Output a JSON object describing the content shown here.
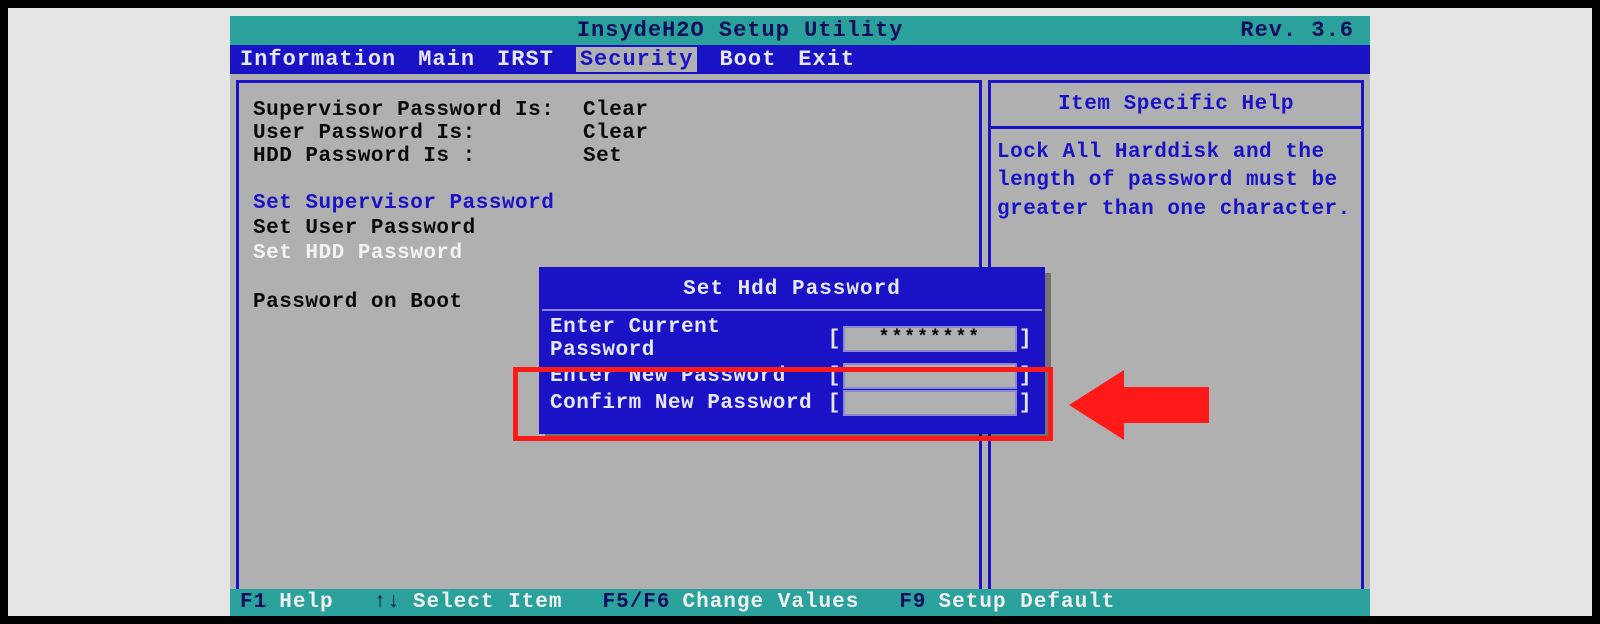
{
  "titlebar": {
    "title": "InsydeH2O Setup Utility",
    "rev": "Rev. 3.6"
  },
  "menubar": {
    "tabs": [
      "Information",
      "Main",
      "IRST",
      "Security",
      "Boot",
      "Exit"
    ],
    "active_index": 3
  },
  "main": {
    "status_rows": [
      {
        "label": "Supervisor Password Is:",
        "value": "Clear"
      },
      {
        "label": "User Password Is:",
        "value": "Clear"
      },
      {
        "label": "HDD Password Is :",
        "value": "Set"
      }
    ],
    "items": {
      "set_supervisor": "Set Supervisor Password",
      "set_user": "Set User Password",
      "set_hdd": "Set HDD Password",
      "pw_on_boot": "Password on Boot"
    }
  },
  "help": {
    "title": "Item Specific Help",
    "body": "Lock All Harddisk and the length of password must be greater than one character."
  },
  "dialog": {
    "title": "Set Hdd Password",
    "current_label": "Enter Current Password",
    "new_label": "Enter New Password",
    "confirm_label": "Confirm New Password",
    "current_value": "********"
  },
  "footer": {
    "f1": "F1",
    "f1_label": "Help",
    "arrows": "↑↓",
    "arrows_label": "Select Item",
    "f56": "F5/F6",
    "f56_label": "Change Values",
    "f9": "F9",
    "f9_label": "Setup Default"
  }
}
